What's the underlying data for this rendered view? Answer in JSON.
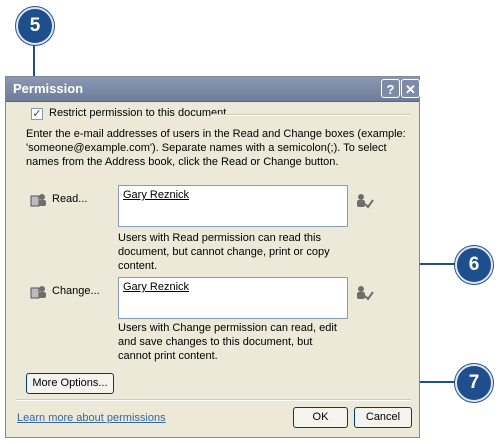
{
  "dialog": {
    "title": "Permission",
    "help_glyph": "?",
    "close_glyph": "✕",
    "restrict_label": "Restrict permission to this document",
    "restrict_checked": true,
    "instructions": "Enter the e-mail addresses of users in the Read and Change boxes (example: 'someone@example.com'). Separate names with a semicolon(;). To select names from the Address book, click the Read or Change button.",
    "read": {
      "button_label": "Read...",
      "user": "Gary Reznick",
      "description": "Users with Read permission can read this document, but cannot change, print or copy content."
    },
    "change": {
      "button_label": "Change...",
      "user": "Gary Reznick",
      "description": "Users with Change permission can read, edit and save changes to this document, but cannot print content."
    },
    "more_options_label": "More Options...",
    "learn_more_link": "Learn more about permissions",
    "ok_label": "OK",
    "cancel_label": "Cancel"
  },
  "callouts": {
    "c5": "5",
    "c6": "6",
    "c7": "7"
  },
  "colors": {
    "callout": "#1f4e8c",
    "titlebar": "#7d8ba6",
    "dialog_bg": "#ece9d8"
  }
}
